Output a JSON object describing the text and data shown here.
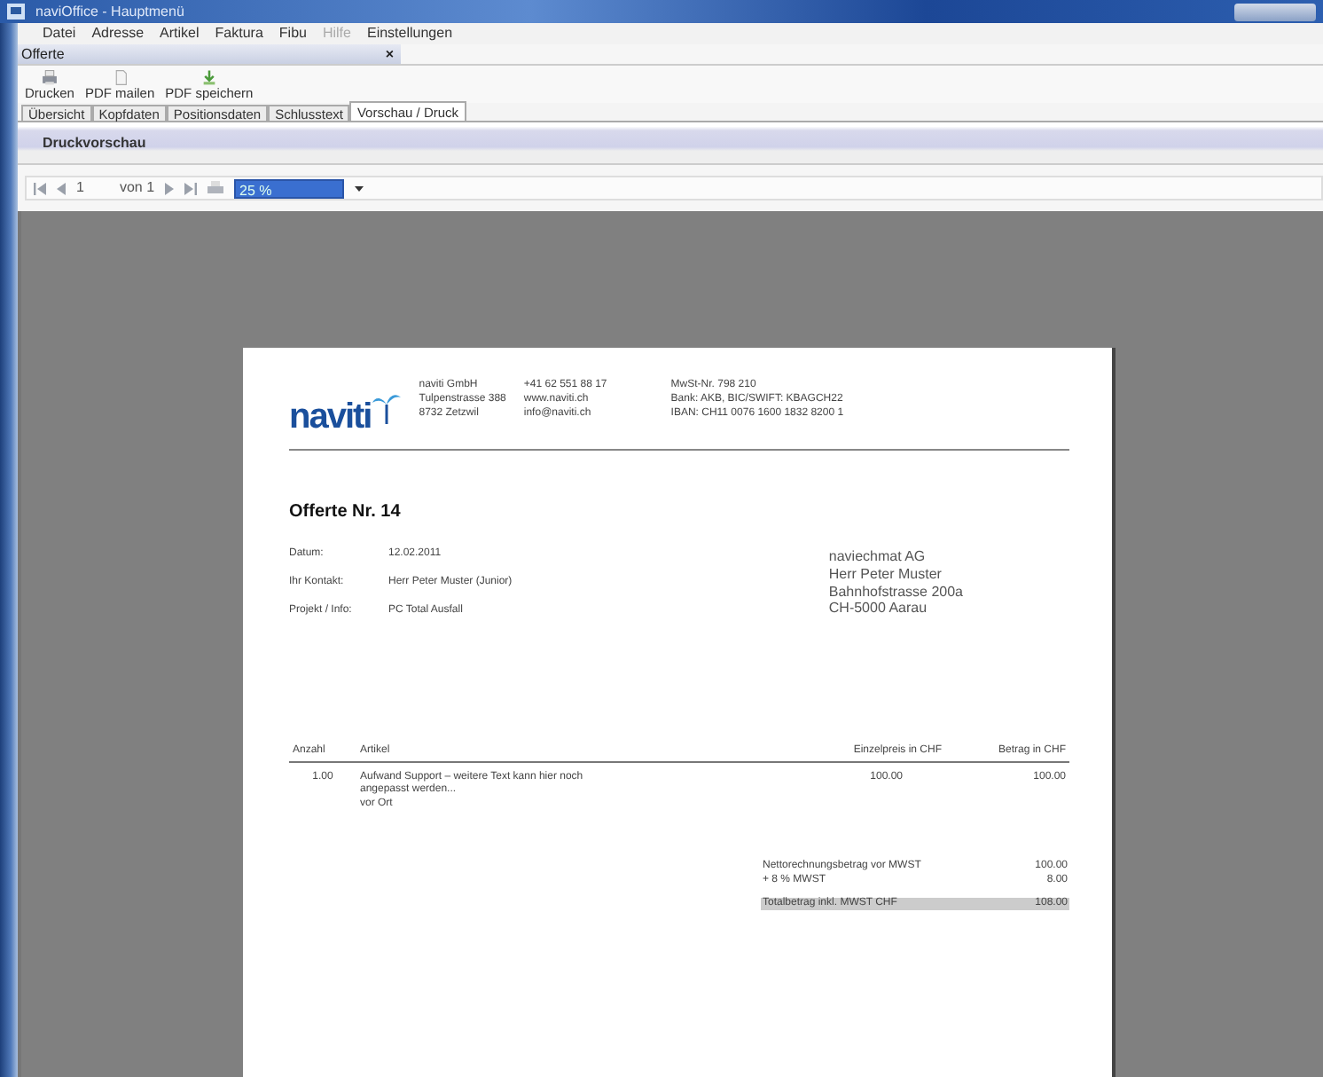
{
  "window": {
    "title": "naviOffice - Hauptmenü"
  },
  "menu": [
    {
      "label": "Datei",
      "disabled": false
    },
    {
      "label": "Adresse",
      "disabled": false
    },
    {
      "label": "Artikel",
      "disabled": false
    },
    {
      "label": "Faktura",
      "disabled": false
    },
    {
      "label": "Fibu",
      "disabled": false
    },
    {
      "label": "Hilfe",
      "disabled": true
    },
    {
      "label": "Einstellungen",
      "disabled": false
    }
  ],
  "document_tab": {
    "label": "Offerte",
    "close": "×"
  },
  "toolbar": [
    {
      "kind": "print",
      "label": "Drucken"
    },
    {
      "kind": "mail",
      "label": "PDF mailen"
    },
    {
      "kind": "save",
      "label": "PDF speichern"
    }
  ],
  "tabs": [
    {
      "label": "Übersicht",
      "selected": false
    },
    {
      "label": "Kopfdaten",
      "selected": false
    },
    {
      "label": "Positionsdaten",
      "selected": false
    },
    {
      "label": "Schlusstext",
      "selected": false
    },
    {
      "label": "Vorschau / Druck",
      "selected": true
    }
  ],
  "section_title": "Druckvorschau",
  "preview_toolbar": {
    "page": "1",
    "page_count": "von 1",
    "zoom": "25 %"
  },
  "document": {
    "logo": "naviti",
    "company": [
      "naviti GmbH",
      "Tulpenstrasse 388",
      "8732 Zetzwil"
    ],
    "contact": [
      "+41 62 551 88 17",
      "www.naviti.ch",
      "info@naviti.ch"
    ],
    "bank": [
      "MwSt-Nr. 798 210",
      "Bank: AKB, BIC/SWIFT: KBAGCH22",
      "IBAN: CH11 0076 1600 1832 8200 1"
    ],
    "title": "Offerte Nr. 14",
    "info": [
      {
        "label": "Datum:",
        "value": "12.02.2011"
      },
      {
        "label": "Ihr Kontakt:",
        "value": "Herr Peter Muster (Junior)"
      },
      {
        "label": "Projekt / Info:",
        "value": "PC Total Ausfall"
      }
    ],
    "address": [
      "naviechmat AG",
      "Herr Peter Muster",
      "Bahnhofstrasse 200a",
      "CH-5000 Aarau"
    ],
    "columns": [
      "Anzahl",
      "Artikel",
      "Einzelpreis in CHF",
      "Betrag in CHF"
    ],
    "rows": [
      {
        "quantity": "1.00",
        "article": [
          "Aufwand Support – weitere Text kann hier noch angepasst werden...",
          "vor Ort"
        ],
        "unit_price": "100.00",
        "amount": "100.00"
      }
    ],
    "totals": [
      {
        "label": "Nettorechnungsbetrag vor MWST",
        "value": "100.00",
        "kind": "plain"
      },
      {
        "label": "+ 8 % MWST",
        "value": "8.00",
        "kind": "plain"
      },
      {
        "label": "Totalbetrag inkl. MWST CHF",
        "value": "108.00",
        "kind": "total"
      }
    ]
  }
}
